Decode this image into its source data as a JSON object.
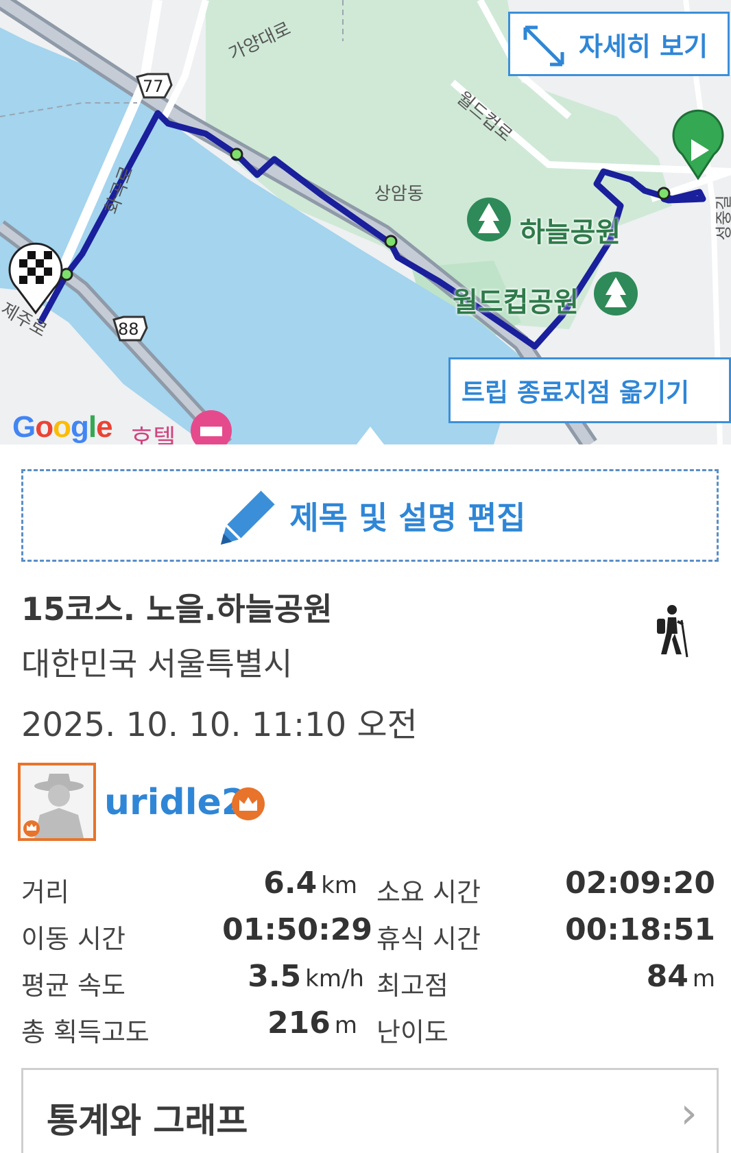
{
  "map": {
    "detail_button": "자세히 보기",
    "move_end_button": "트립 종료지점 옮기기",
    "labels": {
      "gayang": "가양대로",
      "worldcup_ro": "월드컵로",
      "sangam": "상암동",
      "hwagok": "화곡로",
      "seongju": "성중길",
      "jeju": "제주로",
      "haneul_park": "하늘공원",
      "worldcup_park": "월드컵공원",
      "hotel": "호텔",
      "route77": "77",
      "route88": "88",
      "google": "Google"
    },
    "route_color": "#1a1f9c"
  },
  "edit": {
    "label": "제목 및 설명 편집"
  },
  "trip": {
    "title": "15코스. 노을.하늘공원",
    "location": "대한민국 서울특별시",
    "date": "2025. 10. 10. 11:10 오전",
    "activity_icon": "hiking-icon"
  },
  "user": {
    "name": "uridle2",
    "badge_icon": "crown-icon"
  },
  "stats": {
    "distance_label": "거리",
    "distance_value": "6.4",
    "distance_unit": "km",
    "duration_label": "소요 시간",
    "duration_value": "02:09:20",
    "moving_label": "이동 시간",
    "moving_value": "01:50:29",
    "rest_label": "휴식 시간",
    "rest_value": "00:18:51",
    "speed_label": "평균 속도",
    "speed_value": "3.5",
    "speed_unit": "km/h",
    "max_alt_label": "최고점",
    "max_alt_value": "84",
    "max_alt_unit": "m",
    "gain_label": "총 획득고도",
    "gain_value": "216",
    "gain_unit": "m",
    "difficulty_label": "난이도"
  },
  "stats_graph": {
    "label": "통계와 그래프",
    "chevron": "›"
  }
}
